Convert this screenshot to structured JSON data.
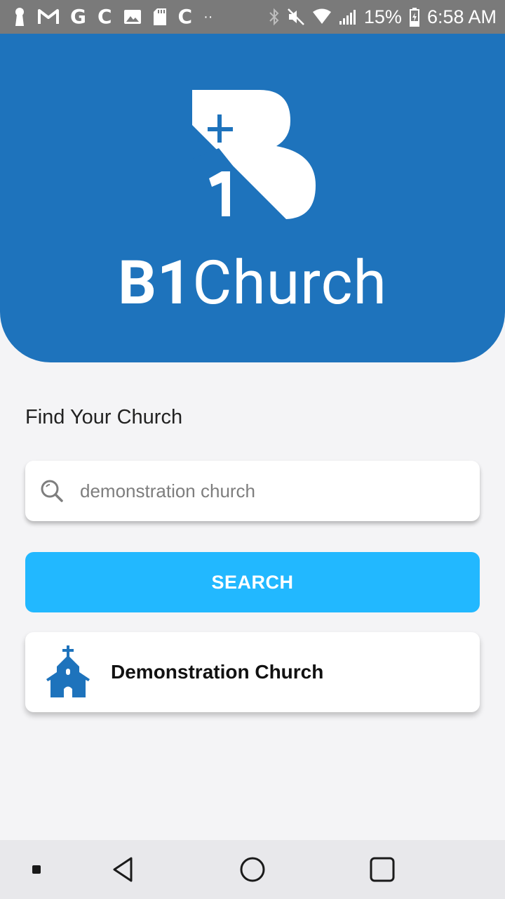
{
  "status_bar": {
    "notification_glyphs": [
      "M",
      "G",
      "C",
      "C"
    ],
    "overflow_dots": "··",
    "battery_percent": "15%",
    "time": "6:58 AM"
  },
  "header": {
    "brand_bold": "B1",
    "brand_regular": "Church",
    "logo_icon": "b1church-logo-icon",
    "background_color": "#1e73bc"
  },
  "main": {
    "find_label": "Find Your Church",
    "search": {
      "value": "demonstration church",
      "icon": "search-icon"
    },
    "search_button_label": "SEARCH",
    "search_button_color": "#22b8ff",
    "results": [
      {
        "name": "Demonstration Church",
        "icon": "church-icon",
        "icon_color": "#1e73bc"
      }
    ]
  },
  "nav_bar": {
    "buttons": [
      "recent-apps",
      "back",
      "home",
      "overview"
    ]
  }
}
